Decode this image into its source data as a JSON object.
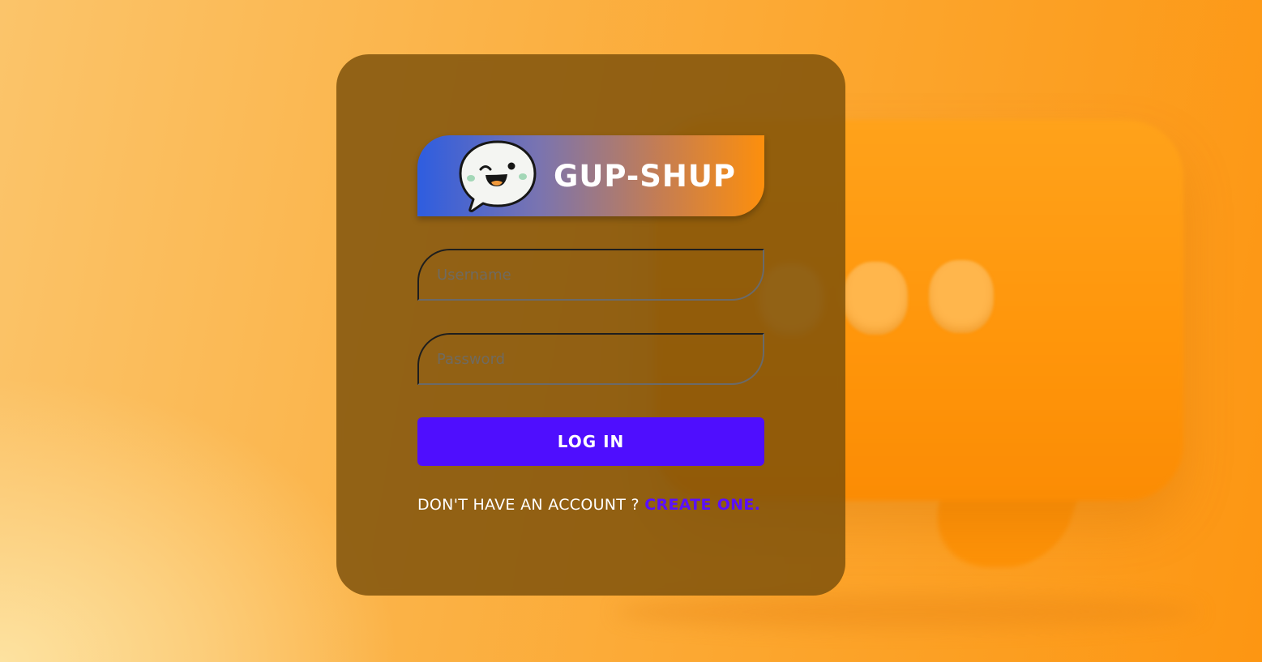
{
  "brand": {
    "title": "GUP-SHUP",
    "logo_icon": "smiling-speech-bubble-icon"
  },
  "form": {
    "username_placeholder": "Username",
    "password_placeholder": "Password",
    "login_label": "LOG IN"
  },
  "signup": {
    "prompt": "DON'T HAVE AN ACCOUNT ? ",
    "link_label": "CREATE ONE."
  },
  "colors": {
    "accent": "#4f0efe",
    "link": "#5a10fb",
    "background_orange": "#fd9612",
    "card": "#7a4f0a",
    "brand_gradient_start": "#2e5de0",
    "brand_gradient_end": "#fd8f0c"
  }
}
